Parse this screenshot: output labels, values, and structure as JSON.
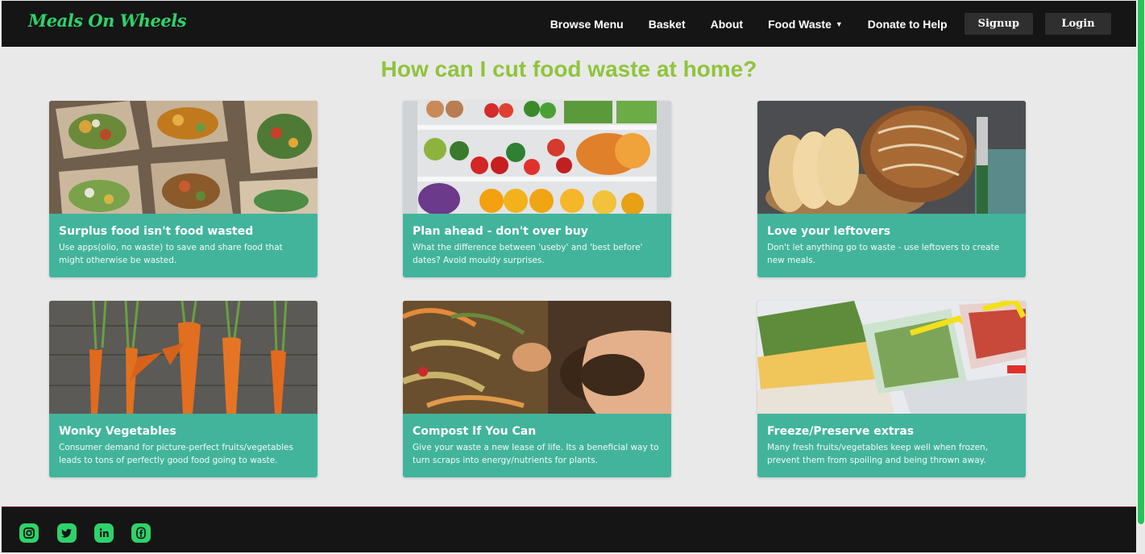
{
  "brand": "Meals On Wheels",
  "nav": {
    "browse_menu": "Browse Menu",
    "basket": "Basket",
    "about": "About",
    "food_waste": "Food Waste",
    "donate": "Donate to Help",
    "signup": "Signup",
    "login": "Login"
  },
  "page_title": "How can I cut food waste at home?",
  "cards": [
    {
      "title": "Surplus food isn't food wasted",
      "desc": "Use apps(olio, no waste) to save and share food that might otherwise be wasted."
    },
    {
      "title": "Plan ahead - don't over buy",
      "desc": "What the difference between 'useby' and 'best before' dates? Avoid mouldy surprises."
    },
    {
      "title": "Love your leftovers",
      "desc": "Don't let anything go to waste - use leftovers to create new meals."
    },
    {
      "title": "Wonky Vegetables",
      "desc": "Consumer demand for picture-perfect fruits/vegetables leads to tons of perfectly good food going to waste."
    },
    {
      "title": "Compost If You Can",
      "desc": "Give your waste a new lease of life. Its a beneficial way to turn scraps into energy/nutrients for plants."
    },
    {
      "title": "Freeze/Preserve extras",
      "desc": "Many fresh fruits/vegetables keep well when frozen, prevent them from spoiling and being thrown away."
    }
  ],
  "footer": {
    "social": [
      "instagram-icon",
      "twitter-icon",
      "linkedin-icon",
      "facebook-icon"
    ]
  },
  "colors": {
    "brand": "#2ed26a",
    "title": "#8fc43b",
    "card": "#42b49b",
    "navbar": "#151515"
  }
}
